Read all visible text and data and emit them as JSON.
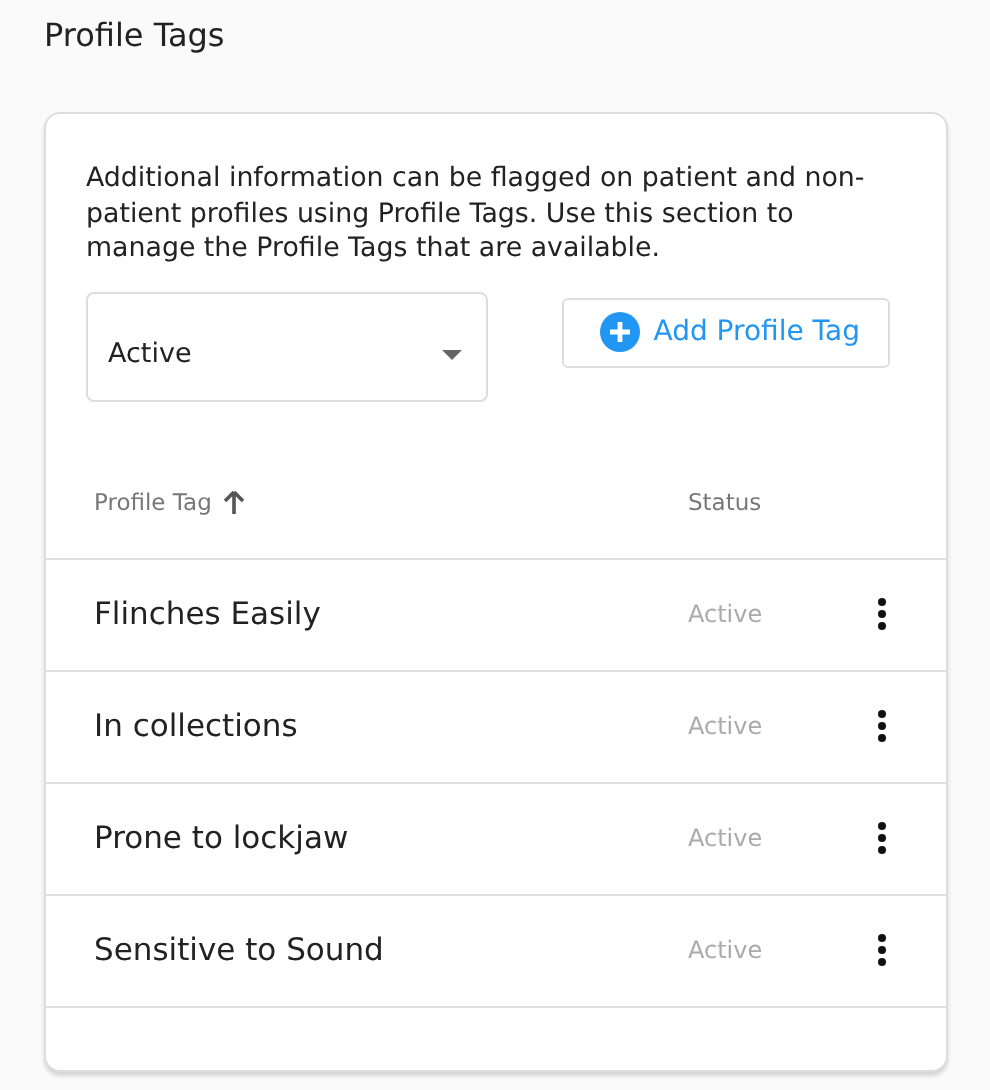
{
  "page": {
    "title": "Profile Tags"
  },
  "description": "Additional information can be flagged on patient and non-patient profiles using Profile Tags. Use this section to manage the Profile Tags that are available.",
  "filter": {
    "value": "Active"
  },
  "add_button": {
    "label": "Add Profile Tag"
  },
  "table": {
    "columns": [
      {
        "label": "Profile Tag",
        "sorted": true
      },
      {
        "label": "Status",
        "sorted": false
      }
    ],
    "rows": [
      {
        "tag": "Flinches Easily",
        "status": "Active"
      },
      {
        "tag": "In collections",
        "status": "Active"
      },
      {
        "tag": "Prone to lockjaw",
        "status": "Active"
      },
      {
        "tag": "Sensitive to Sound",
        "status": "Active"
      }
    ]
  }
}
